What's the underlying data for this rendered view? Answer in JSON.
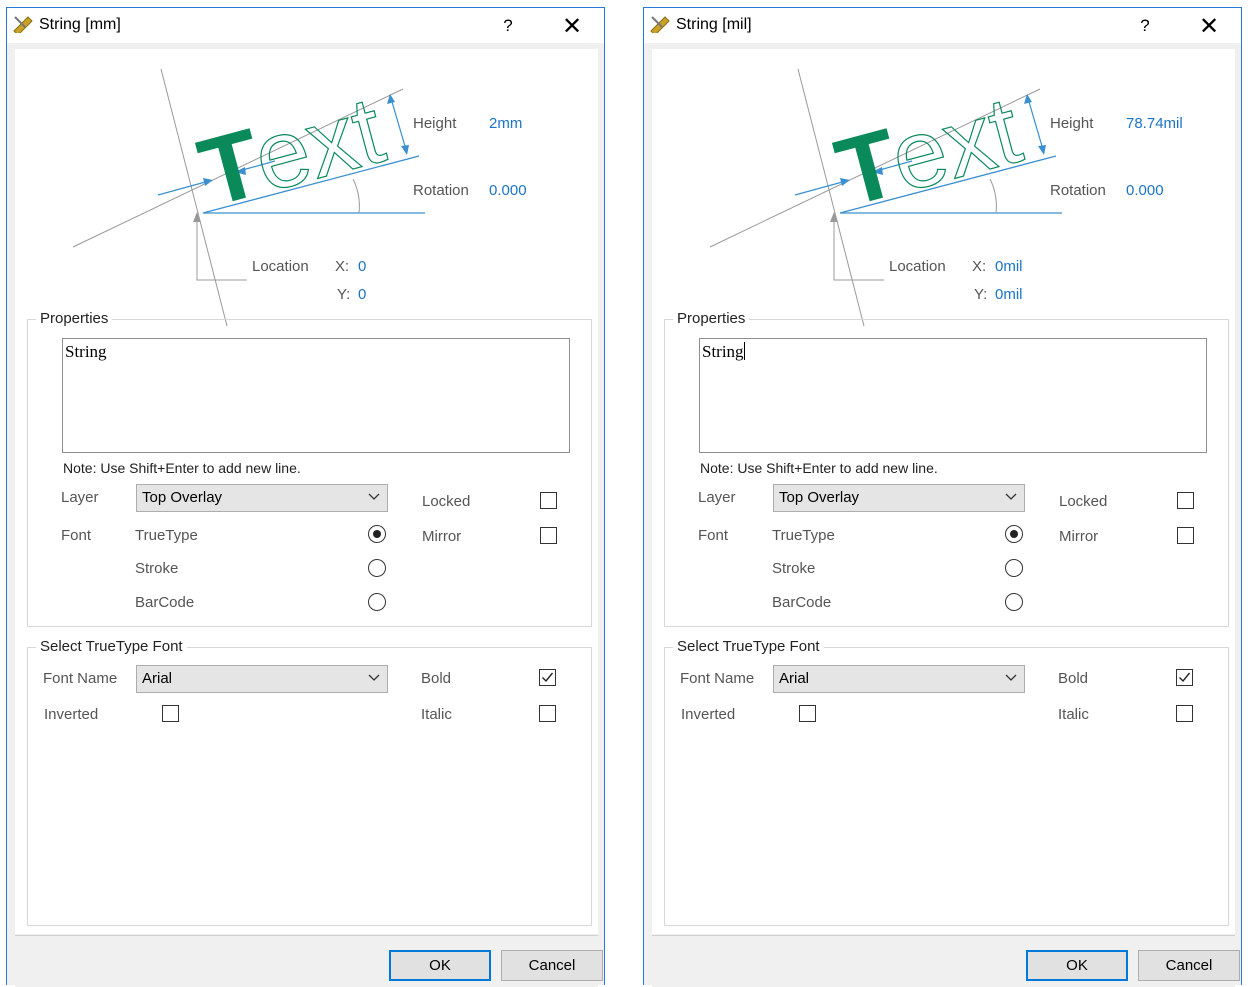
{
  "dialogs": [
    {
      "title": "String  [mm]",
      "help": "?",
      "close": "✕",
      "diagram": {
        "graphic_text": "Text",
        "height_label": "Height",
        "height_value": "2mm",
        "rotation_label": "Rotation",
        "rotation_value": "0.000",
        "location_label": "Location",
        "x_label": "X:",
        "x_value": "0",
        "y_label": "Y:",
        "y_value": "0"
      },
      "properties": {
        "title": "Properties",
        "text_value": "String",
        "note": "Note: Use Shift+Enter to add new line.",
        "layer_label": "Layer",
        "layer_value": "Top Overlay",
        "locked_label": "Locked",
        "mirror_label": "Mirror",
        "font_label": "Font",
        "font_options": [
          "TrueType",
          "Stroke",
          "BarCode"
        ],
        "font_selected": "TrueType",
        "locked": false,
        "mirror": false
      },
      "truetype": {
        "title": "Select TrueType Font",
        "font_name_label": "Font Name",
        "font_name_value": "Arial",
        "bold_label": "Bold",
        "bold": true,
        "italic_label": "Italic",
        "italic": false,
        "inverted_label": "Inverted",
        "inverted": false
      },
      "buttons": {
        "ok": "OK",
        "cancel": "Cancel"
      }
    },
    {
      "title": "String  [mil]",
      "help": "?",
      "close": "✕",
      "diagram": {
        "graphic_text": "Text",
        "height_label": "Height",
        "height_value": "78.74mil",
        "rotation_label": "Rotation",
        "rotation_value": "0.000",
        "location_label": "Location",
        "x_label": "X:",
        "x_value": "0mil",
        "y_label": "Y:",
        "y_value": "0mil"
      },
      "properties": {
        "title": "Properties",
        "text_value": "String",
        "note": "Note: Use Shift+Enter to add new line.",
        "layer_label": "Layer",
        "layer_value": "Top Overlay",
        "locked_label": "Locked",
        "mirror_label": "Mirror",
        "font_label": "Font",
        "font_options": [
          "TrueType",
          "Stroke",
          "BarCode"
        ],
        "font_selected": "TrueType",
        "locked": false,
        "mirror": false
      },
      "truetype": {
        "title": "Select TrueType Font",
        "font_name_label": "Font Name",
        "font_name_value": "Arial",
        "bold_label": "Bold",
        "bold": true,
        "italic_label": "Italic",
        "italic": false,
        "inverted_label": "Inverted",
        "inverted": false
      },
      "buttons": {
        "ok": "OK",
        "cancel": "Cancel"
      }
    }
  ],
  "colors": {
    "accent": "#1b74c8",
    "text_green": "#0a8a5a",
    "window_border": "#2b77d6",
    "default_button_border": "#0078d7"
  }
}
